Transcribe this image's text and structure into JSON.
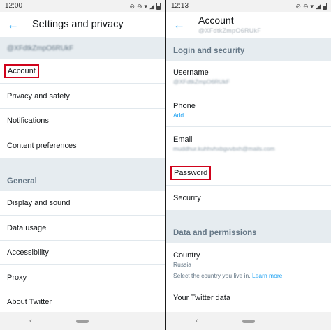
{
  "left": {
    "status": {
      "time": "12:00"
    },
    "title": "Settings and privacy",
    "handle": "@XFdtkZmpO6RUkF",
    "items": [
      "Account",
      "Privacy and safety",
      "Notifications",
      "Content preferences"
    ],
    "general_header": "General",
    "general_items": [
      "Display and sound",
      "Data usage",
      "Accessibility",
      "Proxy",
      "About Twitter"
    ]
  },
  "right": {
    "status": {
      "time": "12:13"
    },
    "title": "Account",
    "handle": "@XFdtkZmpO6RUkF",
    "login_header": "Login and security",
    "username": {
      "label": "Username",
      "value": "@XFdtkZmpO6RUkF"
    },
    "phone": {
      "label": "Phone",
      "action": "Add"
    },
    "email": {
      "label": "Email",
      "value": "muddhur.kuhhvhxbgvvbxh@mails.com"
    },
    "password_label": "Password",
    "security_label": "Security",
    "data_header": "Data and permissions",
    "country": {
      "label": "Country",
      "value": "Russia",
      "desc": "Select the country you live in.",
      "link": "Learn more"
    },
    "twitter_data_label": "Your Twitter data"
  },
  "icons": {
    "back": "←",
    "nav_back": "‹"
  },
  "colors": {
    "accent": "#1da1f2",
    "highlight": "#d0021b",
    "section_bg": "#e6ecf0"
  }
}
